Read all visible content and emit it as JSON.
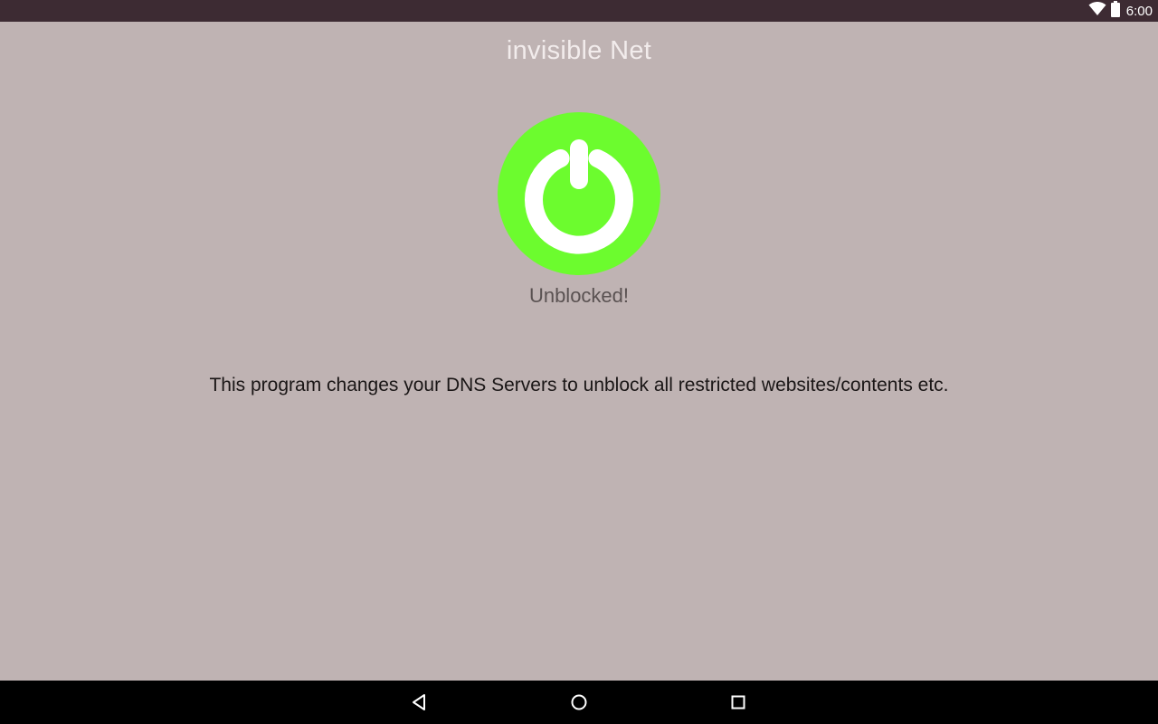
{
  "status_bar": {
    "time": "6:00",
    "icons": [
      "wifi-icon",
      "battery-icon"
    ]
  },
  "app": {
    "title": "invisible Net",
    "power_button": {
      "icon": "power-icon",
      "color": "#6cfc2e"
    },
    "status_text": "Unblocked!",
    "description": "This program changes your DNS Servers to unblock all restricted websites/contents etc."
  },
  "nav_bar": {
    "buttons": [
      "back-icon",
      "home-icon",
      "recents-icon"
    ]
  },
  "colors": {
    "background": "#bfb3b3",
    "status_bar": "#3d2b33",
    "nav_bar": "#000000",
    "accent_green": "#6cfc2e"
  }
}
